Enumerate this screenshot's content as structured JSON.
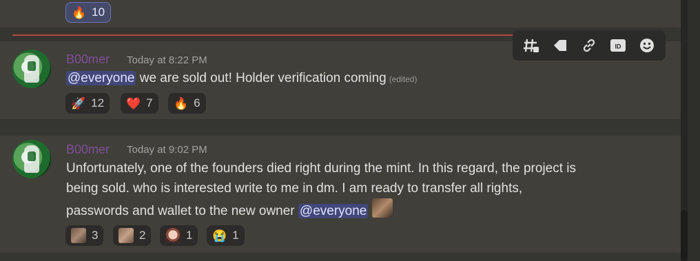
{
  "top_reaction": {
    "emoji": "🔥",
    "count": "10"
  },
  "message_a": {
    "author": "B00mer",
    "timestamp": "Today at 8:22 PM",
    "mention": "@everyone",
    "text": " we are sold out! Holder verification coming",
    "edited": "(edited)",
    "reactions": [
      {
        "emoji": "🚀",
        "count": "12"
      },
      {
        "emoji": "❤️",
        "count": "7"
      },
      {
        "emoji": "🔥",
        "count": "6"
      }
    ]
  },
  "message_b": {
    "author": "B00mer",
    "timestamp": "Today at 9:02 PM",
    "line1": "Unfortunately, one of the founders died right during the mint. In this regard, the project is",
    "line2": "being sold. who is interested write to me in dm. I am ready to transfer all rights,",
    "line3": "passwords and wallet to the new owner ",
    "mention": "@everyone",
    "reactions": [
      {
        "emoji": "face-emoji-1",
        "count": "3"
      },
      {
        "emoji": "face-emoji-2",
        "count": "2"
      },
      {
        "emoji": "face-emoji-3",
        "count": "1"
      },
      {
        "emoji": "😭",
        "count": "1"
      }
    ]
  },
  "toolbar": {
    "icons": [
      "thread-icon",
      "tag-icon",
      "link-icon",
      "id-icon",
      "emoji-icon"
    ],
    "id_label": "ID"
  }
}
